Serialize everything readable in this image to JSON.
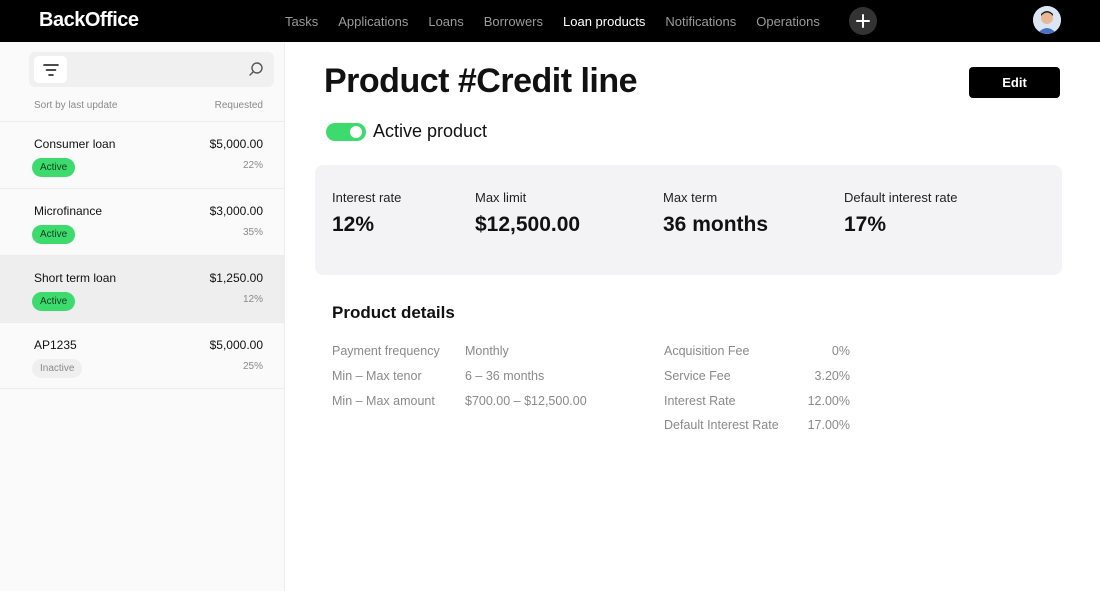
{
  "app": {
    "logo": "BackOffice"
  },
  "nav": {
    "items": [
      {
        "label": "Tasks",
        "active": false
      },
      {
        "label": "Applications",
        "active": false
      },
      {
        "label": "Loans",
        "active": false
      },
      {
        "label": "Borrowers",
        "active": false
      },
      {
        "label": "Loan products",
        "active": true
      },
      {
        "label": "Notifications",
        "active": false
      },
      {
        "label": "Operations",
        "active": false
      }
    ],
    "plus_icon": "plus-icon",
    "avatar_icon": "user-avatar"
  },
  "sidebar": {
    "search_placeholder": "",
    "sort_label": "Sort by last update",
    "requested_label": "Requested",
    "items": [
      {
        "name": "Consumer loan",
        "amount": "$5,000.00",
        "status": "Active",
        "active": true,
        "percent": "22%"
      },
      {
        "name": "Microfinance",
        "amount": "$3,000.00",
        "status": "Active",
        "active": true,
        "percent": "35%"
      },
      {
        "name": "Short term loan",
        "amount": "$1,250.00",
        "status": "Active",
        "active": true,
        "percent": "12%"
      },
      {
        "name": "AP1235",
        "amount": "$5,000.00",
        "status": "Inactive",
        "active": false,
        "percent": "25%"
      }
    ],
    "selected_index": 2
  },
  "main": {
    "title": "Product #Credit line",
    "edit_label": "Edit",
    "toggle_label": "Active product",
    "toggle_on": true,
    "stats": [
      {
        "label": "Interest rate",
        "value": "12%"
      },
      {
        "label": "Max limit",
        "value": "$12,500.00"
      },
      {
        "label": "Max term",
        "value": "36 months"
      },
      {
        "label": "Default interest rate",
        "value": "17%"
      }
    ],
    "details_title": "Product details",
    "details_left": [
      {
        "label": "Payment frequency",
        "value": "Monthly"
      },
      {
        "label": "Min – Max tenor",
        "value": "6 – 36 months"
      },
      {
        "label": "Min – Max amount",
        "value": "$700.00 – $12,500.00"
      }
    ],
    "details_right": [
      {
        "label": "Acquisition Fee",
        "value": "0%"
      },
      {
        "label": "Service Fee",
        "value": "3.20%"
      },
      {
        "label": "Interest Rate",
        "value": "12.00%"
      },
      {
        "label": "Default Interest Rate",
        "value": "17.00%"
      }
    ]
  },
  "colors": {
    "accent_green": "#3ddb6d",
    "topbar": "#000000",
    "card_bg": "#f3f3f5"
  }
}
